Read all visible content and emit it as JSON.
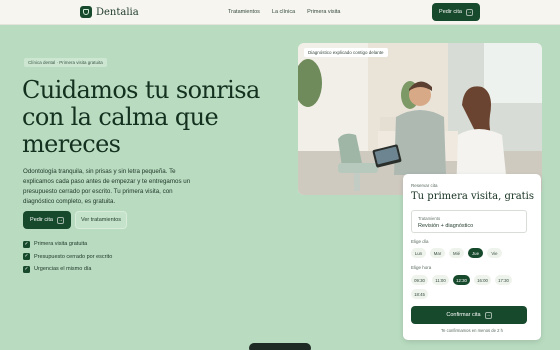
{
  "header": {
    "brand": "Dentalia",
    "nav": [
      "Tratamientos",
      "La clínica",
      "Primera visita"
    ],
    "cta_label": "Pedir cita"
  },
  "hero": {
    "pill": "Clínica dental · Primera visita gratuita",
    "title": "Cuidamos tu sonrisa con la calma que mereces",
    "description": "Odontología tranquila, sin prisas y sin letra pequeña. Te explicamos cada paso antes de empezar y te entregamos un presupuesto cerrado por escrito. Tu primera visita, con diagnóstico completo, es gratuita.",
    "primary_button": "Pedir cita",
    "secondary_button": "Ver tratamientos",
    "checks": [
      "Primera visita gratuita",
      "Presupuesto cerrado por escrito",
      "Urgencias el mismo día"
    ]
  },
  "photo": {
    "tag": "Diagnóstico explicado contigo delante"
  },
  "booking": {
    "label": "Reservar cita",
    "title": "Tu primera visita, gratis",
    "treatment_label": "Tratamiento",
    "treatment_value": "Revisión + diagnóstico",
    "day_label": "Elige día",
    "days": [
      "Lun",
      "Mar",
      "Mié",
      "Jue",
      "Vie"
    ],
    "selected_day": "Jue",
    "time_label": "Elige hora",
    "times": [
      "09:30",
      "11:00",
      "12:30",
      "16:00",
      "17:30",
      "18:45"
    ],
    "selected_time": "12:30",
    "confirm_button": "Confirmar cita",
    "note": "Te confirmamos en menos de 2 h"
  },
  "colors": {
    "accent": "#174a2c",
    "background": "#b9dcc0"
  }
}
